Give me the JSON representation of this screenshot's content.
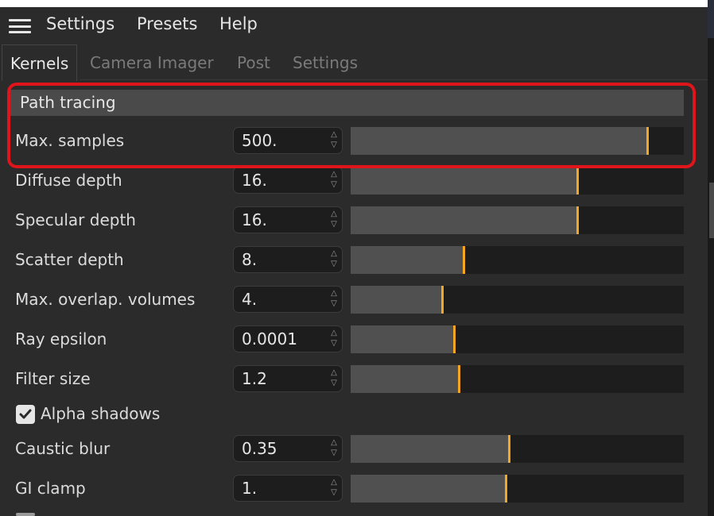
{
  "menu": {
    "items": [
      "Settings",
      "Presets",
      "Help"
    ]
  },
  "tabs": {
    "items": [
      "Kernels",
      "Camera Imager",
      "Post",
      "Settings"
    ],
    "active": "Kernels"
  },
  "section": {
    "title": "Path tracing"
  },
  "rows": [
    {
      "label": "Max. samples",
      "value": "500.",
      "level": 0.89
    },
    {
      "label": "Diffuse depth",
      "value": "16.",
      "level": 0.68
    },
    {
      "label": "Specular depth",
      "value": "16.",
      "level": 0.68
    },
    {
      "label": "Scatter depth",
      "value": "8.",
      "level": 0.34
    },
    {
      "label": "Max. overlap. volumes",
      "value": "4.",
      "level": 0.275
    },
    {
      "label": "Ray epsilon",
      "value": "0.0001",
      "level": 0.31
    },
    {
      "label": "Filter size",
      "value": "1.2",
      "level": 0.325
    }
  ],
  "checkbox": {
    "label": "Alpha shadows",
    "checked": true
  },
  "rows2": [
    {
      "label": "Caustic blur",
      "value": "0.35",
      "level": 0.475
    },
    {
      "label": "GI clamp",
      "value": "1.",
      "level": 0.465
    }
  ],
  "colors": {
    "accent": "#f5a623",
    "highlight": "#e0141b",
    "background": "#2b2b2b",
    "slider_fill": "#505050",
    "field_bg": "#1d1d1d"
  },
  "icons": {
    "menu": "hamburger-icon",
    "stepper": "up-down-chevron-icon",
    "check": "checkmark-icon"
  }
}
